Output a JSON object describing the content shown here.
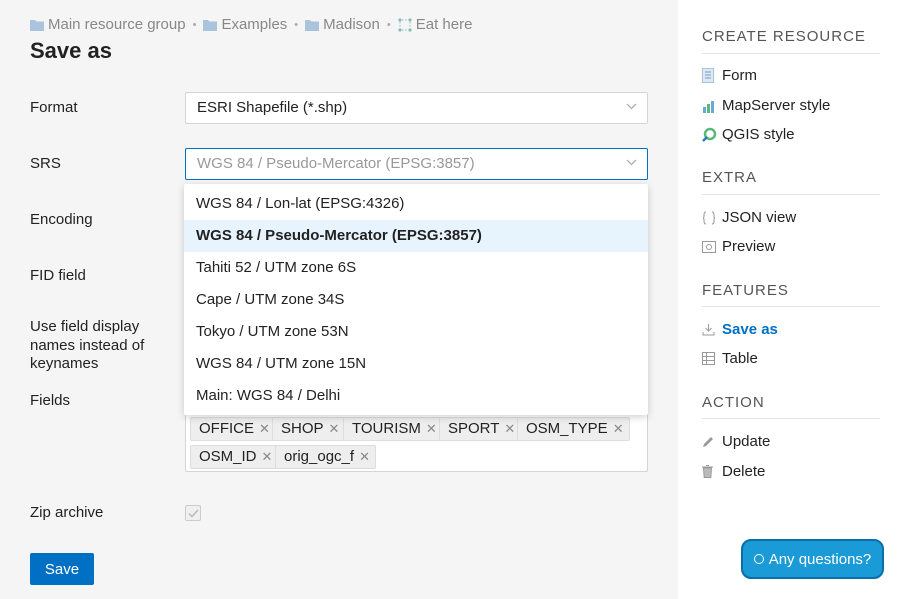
{
  "breadcrumb": {
    "items": [
      {
        "label": "Main resource group",
        "icon": "folder-icon"
      },
      {
        "label": "Examples",
        "icon": "folder-icon"
      },
      {
        "label": "Madison",
        "icon": "folder-icon"
      },
      {
        "label": "Eat here",
        "icon": "vector-layer-icon"
      }
    ],
    "separator": "•"
  },
  "page": {
    "title": "Save as"
  },
  "form": {
    "format": {
      "label": "Format",
      "value": "ESRI Shapefile (*.shp)"
    },
    "srs": {
      "label": "SRS",
      "value": "WGS 84 / Pseudo-Mercator (EPSG:3857)",
      "options": [
        "WGS 84 / Lon-lat (EPSG:4326)",
        "WGS 84 / Pseudo-Mercator (EPSG:3857)",
        "Tahiti 52 / UTM zone 6S",
        "Cape / UTM zone 34S",
        "Tokyo / UTM zone 53N",
        "WGS 84 / UTM zone 15N",
        "Main: WGS 84 / Delhi"
      ],
      "selected_index": 1
    },
    "encoding": {
      "label": "Encoding"
    },
    "fid_field": {
      "label": "FID field"
    },
    "display_names": {
      "label_lines": [
        "Use field display",
        "names instead of",
        "keynames"
      ]
    },
    "fields": {
      "label": "Fields",
      "tags": [
        "OFFICE",
        "SHOP",
        "TOURISM",
        "SPORT",
        "OSM_TYPE",
        "OSM_ID",
        "orig_ogc_f"
      ]
    },
    "zip": {
      "label": "Zip archive",
      "checked": true
    },
    "save_label": "Save"
  },
  "sidebar": {
    "sections": [
      {
        "title": "CREATE RESOURCE",
        "items": [
          {
            "label": "Form",
            "icon": "form-icon"
          },
          {
            "label": "MapServer style",
            "icon": "mapserver-style-icon"
          },
          {
            "label": "QGIS style",
            "icon": "qgis-style-icon"
          }
        ]
      },
      {
        "title": "EXTRA",
        "items": [
          {
            "label": "JSON view",
            "icon": "json-icon"
          },
          {
            "label": "Preview",
            "icon": "preview-icon"
          }
        ]
      },
      {
        "title": "FEATURES",
        "items": [
          {
            "label": "Save as",
            "icon": "download-icon",
            "active": true
          },
          {
            "label": "Table",
            "icon": "table-icon"
          }
        ]
      },
      {
        "title": "ACTION",
        "items": [
          {
            "label": "Update",
            "icon": "pencil-icon"
          },
          {
            "label": "Delete",
            "icon": "trash-icon"
          }
        ]
      }
    ]
  },
  "help": {
    "label": "Any questions?"
  },
  "colors": {
    "accent": "#0070c5",
    "help_button": "#1a9ad6",
    "main_bg": "#f5f5f5",
    "selected_option_bg": "#e8f4fd"
  }
}
